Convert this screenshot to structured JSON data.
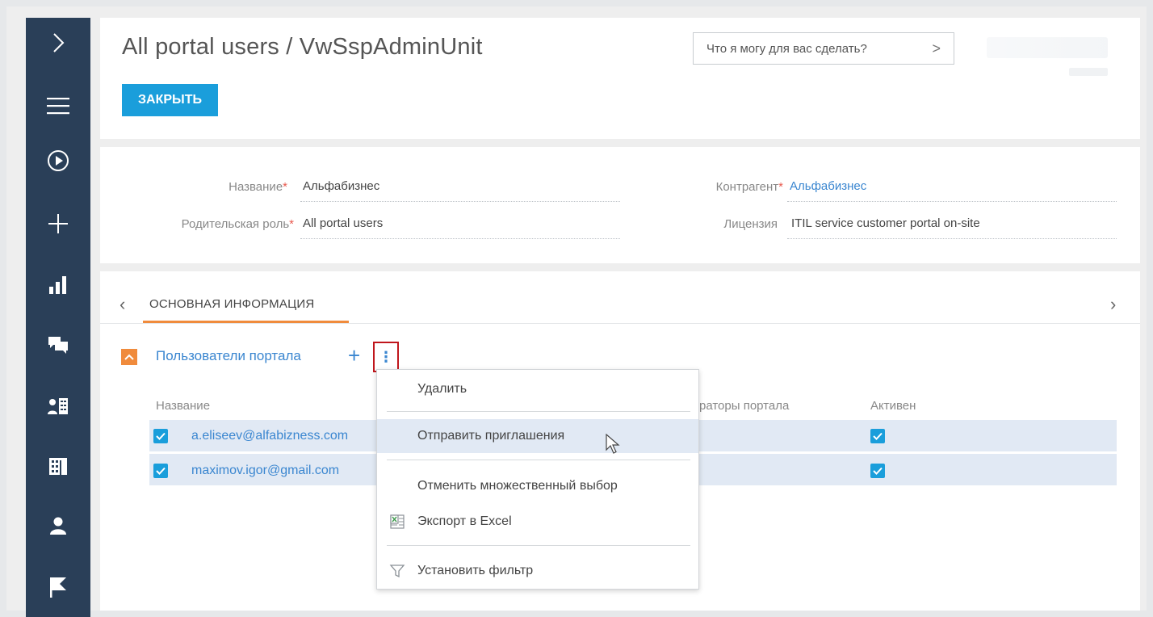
{
  "header": {
    "title": "All portal users / VwSspAdminUnit",
    "close_label": "ЗАКРЫТЬ",
    "search_placeholder": "Что я могу для вас сделать?",
    "search_chevron": ">"
  },
  "sidebar": {
    "items": [
      {
        "icon": "chevron-right-icon"
      },
      {
        "icon": "menu-icon"
      },
      {
        "icon": "play-circle-icon"
      },
      {
        "icon": "plus-icon"
      },
      {
        "icon": "bar-chart-icon"
      },
      {
        "icon": "chat-icon"
      },
      {
        "icon": "contacts-icon"
      },
      {
        "icon": "building-icon"
      },
      {
        "icon": "user-icon"
      },
      {
        "icon": "flag-icon"
      }
    ]
  },
  "fields": {
    "name_label": "Название",
    "name_value": "Альфабизнес",
    "parent_role_label": "Родительская роль",
    "parent_role_value": "All portal users",
    "account_label": "Контрагент",
    "account_value": "Альфабизнес",
    "license_label": "Лицензия",
    "license_value": "ITIL service customer portal on-site",
    "required_mark": "*"
  },
  "tabs": {
    "active_label": "ОСНОВНАЯ ИНФОРМАЦИЯ",
    "prev_arrow": "‹",
    "next_arrow": "›"
  },
  "detail": {
    "title": "Пользователи портала",
    "add_label": "+",
    "more_label": "⋮",
    "columns": {
      "name": "Название",
      "admins_partial": "раторы портала",
      "active": "Активен"
    },
    "rows": [
      {
        "email": "a.eliseev@alfabizness.com",
        "selected": true,
        "active": true
      },
      {
        "email": "maximov.igor@gmail.com",
        "selected": true,
        "active": true
      }
    ]
  },
  "menu": {
    "items": [
      {
        "label": "Удалить"
      },
      {
        "label": "Отправить приглашения"
      },
      {
        "label": "Отменить множественный выбор"
      },
      {
        "label": "Экспорт в Excel"
      },
      {
        "label": "Установить фильтр"
      }
    ]
  },
  "colors": {
    "sidebar": "#2a3f58",
    "accent_blue": "#1a9edb",
    "link_blue": "#3a86d0",
    "tab_orange": "#f08b3c",
    "row_selected": "#e1e9f4",
    "highlight_border": "#c0161c"
  }
}
